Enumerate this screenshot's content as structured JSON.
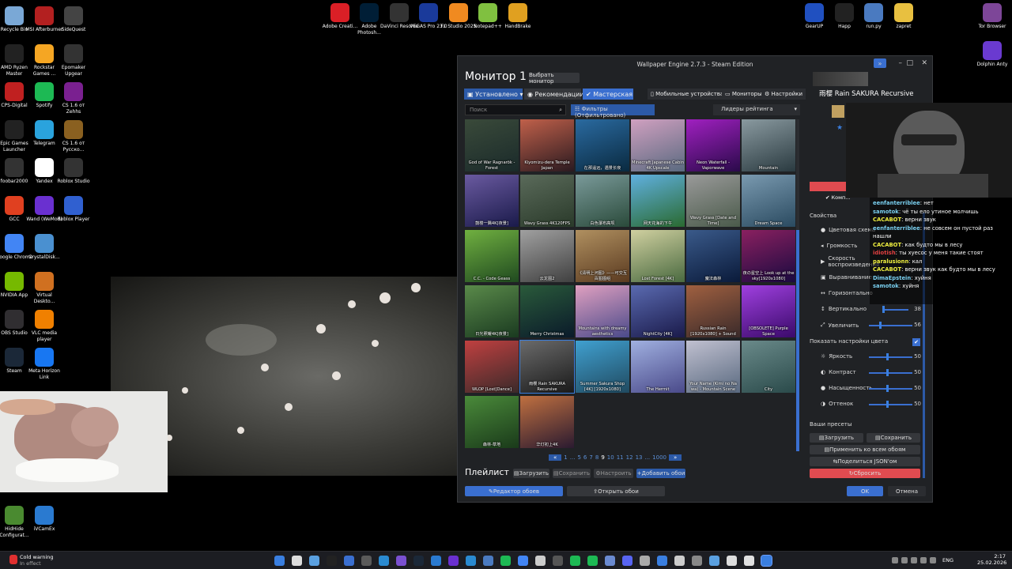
{
  "desktop_icons": [
    {
      "label": "Recycle Bin",
      "color": "#7aa8d6"
    },
    {
      "label": "MSI Afterburner",
      "color": "#b32020"
    },
    {
      "label": "SideQuest",
      "color": "#444"
    },
    {
      "label": "AMD Ryzen Master",
      "color": "#222"
    },
    {
      "label": "Rockstar Games ...",
      "color": "#f5a623"
    },
    {
      "label": "Epomaker Upgear",
      "color": "#333"
    },
    {
      "label": "CPS-Digital",
      "color": "#c02020"
    },
    {
      "label": "Spotify",
      "color": "#1db954"
    },
    {
      "label": "CS 1.6 от Zehhs",
      "color": "#7a2090"
    },
    {
      "label": "Epic Games Launcher",
      "color": "#222"
    },
    {
      "label": "Telegram",
      "color": "#2aa3dd"
    },
    {
      "label": "CS 1.6 от Русско...",
      "color": "#8a6020"
    },
    {
      "label": "foobar2000",
      "color": "#333"
    },
    {
      "label": "Yandex",
      "color": "#fff"
    },
    {
      "label": "Roblox Studio",
      "color": "#333"
    },
    {
      "label": "GCC",
      "color": "#e04020"
    },
    {
      "label": "Wand (WeMod)",
      "color": "#6a30d0"
    },
    {
      "label": "Roblox Player",
      "color": "#3060d0"
    },
    {
      "label": "Google Chrome",
      "color": "#4285f4"
    },
    {
      "label": "CrystalDisk...",
      "color": "#4a90d0"
    },
    {
      "label": "NVIDIA App",
      "color": "#76b900"
    },
    {
      "label": "Virtual Deskto...",
      "color": "#d07020"
    },
    {
      "label": "OBS Studio",
      "color": "#302e31"
    },
    {
      "label": "VLC media player",
      "color": "#f08000"
    },
    {
      "label": "Steam",
      "color": "#1b2838"
    },
    {
      "label": "Meta Horizon Link",
      "color": "#1877f2"
    },
    {
      "label": "HidHide Configurat...",
      "color": "#4a8a30"
    },
    {
      "label": "iVCamEx",
      "color": "#2a7ad0"
    },
    {
      "label": "Adobe Creati...",
      "color": "#da1f26"
    },
    {
      "label": "Adobe Photosh...",
      "color": "#001e36"
    },
    {
      "label": "DaVinci Resolve",
      "color": "#333"
    },
    {
      "label": "VEGAS Pro 23.0",
      "color": "#1a3a9a"
    },
    {
      "label": "FL Studio 2025",
      "color": "#f08a20"
    },
    {
      "label": "Notepad++",
      "color": "#80c040"
    },
    {
      "label": "HandBrake",
      "color": "#e0a020"
    },
    {
      "label": "GearUP",
      "color": "#2050c0"
    },
    {
      "label": "Happ",
      "color": "#222"
    },
    {
      "label": "run.py",
      "color": "#4a7ac0"
    },
    {
      "label": "zapret",
      "color": "#e8c040"
    },
    {
      "label": "Tor Browser",
      "color": "#7d4698"
    },
    {
      "label": "Dolphin Anty",
      "color": "#6a3ad0"
    }
  ],
  "window": {
    "title": "Wallpaper Engine 2.7.3 - Steam Edition",
    "heading": "Монитор 1",
    "choose_monitor": "Выбрать монитор",
    "tabs": [
      "Установлено",
      "Рекомендации",
      "Мастерская"
    ],
    "top_links": [
      "Мобильные устройства",
      "Мониторы",
      "Настройки"
    ],
    "search_placeholder": "Поиск",
    "filters": "Фильтры (Отфильтровано)",
    "sort": "Лидеры рейтинга",
    "tiles": [
      {
        "label": "God of War Ragnarök - Forest",
        "c1": "#3a4a3a",
        "c2": "#1a2a2a"
      },
      {
        "label": "Kiyomizu-dera Temple Japan",
        "c1": "#c0604a",
        "c2": "#2a1a20"
      },
      {
        "label": "在那遥远，遇景长夜",
        "c1": "#2a6aa0",
        "c2": "#0a2a40"
      },
      {
        "label": "Minecraft Japanese Cabin 4K Upscale",
        "c1": "#d0a0c0",
        "c2": "#5a6a80"
      },
      {
        "label": "Neon Waterfall - Vaporwave",
        "c1": "#a020c0",
        "c2": "#2a0a4a"
      },
      {
        "label": "Mountain",
        "c1": "#8a9aa0",
        "c2": "#2a3a40"
      },
      {
        "label": "鼓楼一隅4K[夜景]",
        "c1": "#6a5aa0",
        "c2": "#1a1a4a"
      },
      {
        "label": "Wavy Grass 4K120FPS",
        "c1": "#5a6a5a",
        "c2": "#2a3a2a"
      },
      {
        "label": "白色瀑布高坝",
        "c1": "#7a9a9a",
        "c2": "#2a4a3a"
      },
      {
        "label": "网天花海的下午",
        "c1": "#60b0e0",
        "c2": "#2a6a30"
      },
      {
        "label": "Wavy Grass [Date and Time]",
        "c1": "#9a9a9a",
        "c2": "#4a5a4a"
      },
      {
        "label": "Dream Space",
        "c1": "#7a9ab0",
        "c2": "#2a4a60"
      },
      {
        "label": "C.C. - Code Geass",
        "c1": "#70b040",
        "c2": "#204a20"
      },
      {
        "label": "云龙图2",
        "c1": "#a0a0a0",
        "c2": "#404040"
      },
      {
        "label": "《清明上河图》——可交互百图图组",
        "c1": "#b09060",
        "c2": "#5a3a20"
      },
      {
        "label": "Lost Forest [4K]",
        "c1": "#d0d0a0",
        "c2": "#4a6a40"
      },
      {
        "label": "魔法森林",
        "c1": "#3a5a8a",
        "c2": "#0a1a3a"
      },
      {
        "label": "夜の星空上 Look up at the sky[1920x1080]",
        "c1": "#8a2060",
        "c2": "#1a0a40"
      },
      {
        "label": "日光照耀4K[夜景]",
        "c1": "#5a8a4a",
        "c2": "#1a3a20"
      },
      {
        "label": "Merry Christmas",
        "c1": "#2a5a3a",
        "c2": "#0a1a2a"
      },
      {
        "label": "Mountains with dreamy aesthetics",
        "c1": "#e0a0c0",
        "c2": "#4a4a8a"
      },
      {
        "label": "NightCity [4K]",
        "c1": "#5a6ab0",
        "c2": "#1a1a4a"
      },
      {
        "label": "Russian Rain [1920x1080] + Sound",
        "c1": "#a06040",
        "c2": "#3a2a2a"
      },
      {
        "label": "[OBSOLETE] Purple Space",
        "c1": "#a040e0",
        "c2": "#3a0a6a"
      },
      {
        "label": "WLOP [Lost]Dance]",
        "c1": "#c04040",
        "c2": "#3a2a2a"
      },
      {
        "label": "雨樱 Rain SAKURA Recursive",
        "c1": "#6a6a6a",
        "c2": "#1a1a1a"
      },
      {
        "label": "Summer Sakura Shop [4K] [1920x1080]",
        "c1": "#40a0d0",
        "c2": "#204a60"
      },
      {
        "label": "The Hermit",
        "c1": "#a0b0e0",
        "c2": "#4a4a8a"
      },
      {
        "label": "Your Name (Kimi no Na wa) - Mountain Scene",
        "c1": "#c0c0d0",
        "c2": "#5a6a80"
      },
      {
        "label": "City",
        "c1": "#6a8a8a",
        "c2": "#2a4a4a"
      },
      {
        "label": "森林-草地",
        "c1": "#4a8a3a",
        "c2": "#1a3a1a"
      },
      {
        "label": "华灯初上4K",
        "c1": "#c07040",
        "c2": "#2a1a30"
      }
    ],
    "pages": [
      "«",
      "1",
      "...",
      "5",
      "6",
      "7",
      "8",
      "9",
      "10",
      "11",
      "12",
      "13",
      "...",
      "1000",
      "»"
    ],
    "playlist": "Плейлист",
    "playlist_buttons": [
      "Загрузить",
      "Сохранить",
      "Настроить",
      "Добавить обои"
    ],
    "editor_button": "Редактор обоев",
    "open_button": "Открыть обои",
    "ok": "OK",
    "cancel": "Отмена",
    "selected_title": "雨樱 Rain SAKURA Recursive",
    "compat": "Комп...",
    "properties": "Свойства",
    "settings": [
      {
        "label": "Цветовая схема",
        "value": ""
      },
      {
        "label": "Громкость",
        "value": ""
      },
      {
        "label": "Скорость воспроизведения",
        "value": ""
      },
      {
        "label": "Выравнивание",
        "value": ""
      },
      {
        "label": "Горизонтально",
        "value": ""
      },
      {
        "label": "Вертикально",
        "value": "38"
      },
      {
        "label": "Увеличить",
        "value": "56"
      }
    ],
    "color_toggle": "Показать настройки цвета",
    "color_settings": [
      {
        "label": "Яркость",
        "value": "50"
      },
      {
        "label": "Контраст",
        "value": "50"
      },
      {
        "label": "Насыщенность",
        "value": "50"
      },
      {
        "label": "Оттенок",
        "value": "50"
      }
    ],
    "presets": "Ваши пресеты",
    "load": "Загрузить",
    "save": "Сохранить",
    "apply_all": "Применить ко всем обоям",
    "share": "Поделиться JSON'ом",
    "reset": "Сбросить"
  },
  "chat": [
    {
      "name": "eenfanterriblee",
      "color": "#7ad0f0",
      "text": "нет"
    },
    {
      "name": "samotok",
      "color": "#7ad0f0",
      "text": "чё ты ело утиное молчишь"
    },
    {
      "name": "CACABOT",
      "color": "#f0f040",
      "text": "верни звук"
    },
    {
      "name": "eenfanterriblee",
      "color": "#7ad0f0",
      "text": "не совсем он пустой раз нашли"
    },
    {
      "name": "CACABOT",
      "color": "#f0f040",
      "text": "как будто мы в лесу"
    },
    {
      "name": "idiotish",
      "color": "#e04040",
      "text": "ты хуесос у меня такие стоят"
    },
    {
      "name": "paralusionn",
      "color": "#f0f040",
      "text": "кал"
    },
    {
      "name": "CACABOT",
      "color": "#f0f040",
      "text": "верни звук как будто мы в лесу"
    },
    {
      "name": "DimaEpstein",
      "color": "#7ad0f0",
      "text": "хуйня"
    },
    {
      "name": "samotok",
      "color": "#7ad0f0",
      "text": "хуйня"
    }
  ],
  "taskbar": {
    "notice_title": "Cold warning",
    "notice_sub": "In effect",
    "lang": "ENG",
    "time": "2:17",
    "date": "25.02.2026"
  }
}
